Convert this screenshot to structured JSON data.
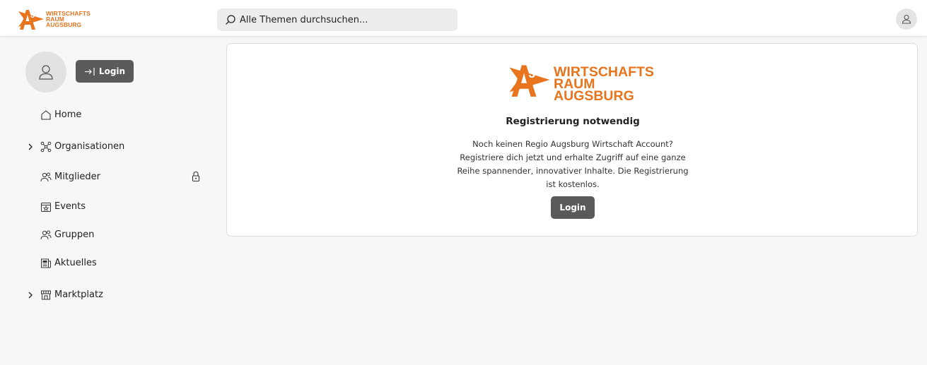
{
  "brand": {
    "logo_lines": [
      "WIRTSCHAFTS",
      "RAUM",
      "AUGSBURG"
    ],
    "color": "#e8741e"
  },
  "search": {
    "placeholder": "Alle Themen durchsuchen...",
    "icon": "search-icon"
  },
  "header": {
    "user_icon": "user-icon"
  },
  "sidebar": {
    "login_label": "Login",
    "items": [
      {
        "label": "Home",
        "icon": "home-icon",
        "expandable": false,
        "locked": false
      },
      {
        "label": "Organisationen",
        "icon": "network-icon",
        "expandable": true,
        "locked": false
      },
      {
        "label": "Mitglieder",
        "icon": "members-icon",
        "expandable": false,
        "locked": true
      },
      {
        "label": "Events",
        "icon": "calendar-star-icon",
        "expandable": false,
        "locked": false
      },
      {
        "label": "Gruppen",
        "icon": "groups-icon",
        "expandable": false,
        "locked": false
      },
      {
        "label": "Aktuelles",
        "icon": "newspaper-icon",
        "expandable": false,
        "locked": false
      },
      {
        "label": "Marktplatz",
        "icon": "store-icon",
        "expandable": true,
        "locked": false
      }
    ]
  },
  "main": {
    "title": "Registrierung notwendig",
    "text": "Noch keinen Regio Augsburg Wirtschaft Account? Registriere dich jetzt und erhalte Zugriff auf eine ganze Reihe spannender, innovativer Inhalte. Die Registrierung ist kostenlos.",
    "login_label": "Login"
  },
  "colors": {
    "accent": "#e8741e",
    "button": "#5a5a5a",
    "background": "#f7f7f8"
  }
}
